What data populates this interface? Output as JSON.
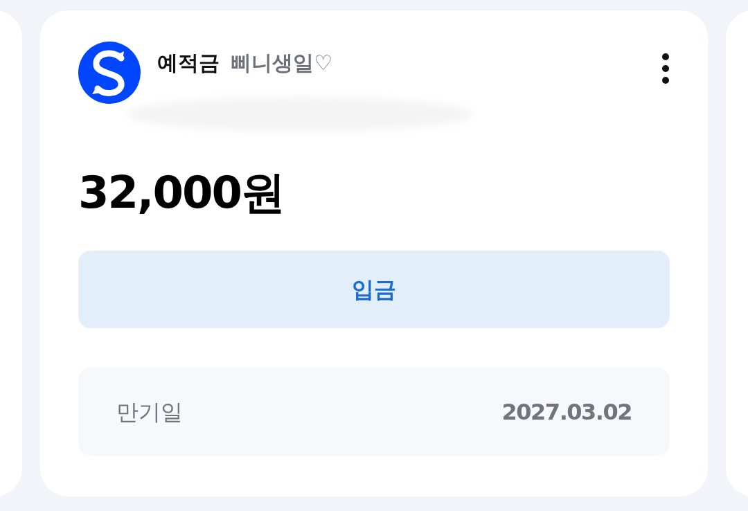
{
  "account": {
    "type": "예적금",
    "nickname": "삐니생일♡"
  },
  "balance": "32,000원",
  "deposit_button": {
    "label": "입금"
  },
  "maturity": {
    "label": "만기일",
    "value": "2027.03.02"
  }
}
